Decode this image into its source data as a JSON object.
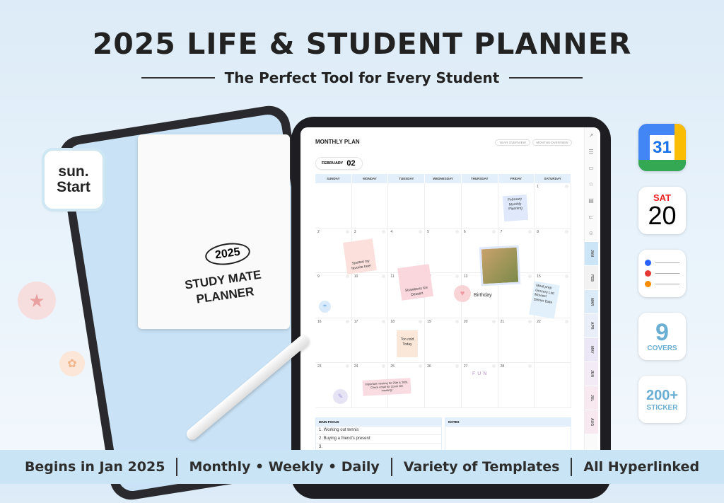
{
  "header": {
    "title": "2025 LIFE & STUDENT PLANNER",
    "subtitle": "The Perfect Tool for Every Student"
  },
  "logo": {
    "line1": "sun.",
    "line2": "Start"
  },
  "cover": {
    "year": "2025",
    "name": "STUDY MATE PLANNER"
  },
  "planner": {
    "title": "MONTHLY PLAN",
    "buttons": [
      "YEAR OVERVIEW",
      "MONTHS OVERVIEW"
    ],
    "month_label": "FEBRUARY",
    "month_num": "02",
    "weekdays": [
      "SUNDAY",
      "MONDAY",
      "TUESDAY",
      "WEDNESDAY",
      "THURSDAY",
      "FRIDAY",
      "SATURDAY"
    ],
    "days": [
      "",
      "",
      "",
      "",
      "",
      "",
      "1",
      "2",
      "3",
      "4",
      "5",
      "6",
      "7",
      "8",
      "9",
      "10",
      "11",
      "12",
      "13",
      "14",
      "15",
      "16",
      "17",
      "18",
      "19",
      "20",
      "21",
      "22",
      "23",
      "24",
      "25",
      "26",
      "27",
      "28",
      ""
    ],
    "stickers": {
      "planning": "February Monthly Planning",
      "tree": "Spotted my favorite tree!",
      "dessert": "Strawberry Ice Dessert",
      "birthday": "Birthday",
      "cold": "Too cold Today",
      "meeting": "Important meeting for 25th & 26th. Check email for Zoom link meeting!",
      "fun": "FUN",
      "list": [
        "Meal prep",
        "Grocery List",
        "Movies!",
        "Dinner Date"
      ]
    },
    "main_focus": {
      "title": "MAIN FOCUS",
      "items": [
        "1. Working out tennis",
        "2. Buying a friend's present",
        "3."
      ]
    },
    "notes": {
      "title": "NOTES"
    },
    "month_tabs": [
      "JAN",
      "FEB",
      "MAR",
      "APR",
      "MAY",
      "JUN",
      "JUL",
      "AUG"
    ],
    "tab_colors": [
      "#cbe5f6",
      "#f2f2f2",
      "#dcebf8",
      "#e9eef9",
      "#ece7f6",
      "#f3ecf7",
      "#f8e9f1",
      "#f8e9f1"
    ]
  },
  "apps": {
    "gcal_day": "31",
    "cal_weekday": "SAT",
    "cal_day": "20",
    "covers_num": "9",
    "covers_label": "COVERS",
    "sticker_num": "200+",
    "sticker_label": "STICKER"
  },
  "bottom": [
    "Begins in Jan 2025",
    "Monthly • Weekly • Daily",
    "Variety of Templates",
    "All Hyperlinked"
  ]
}
